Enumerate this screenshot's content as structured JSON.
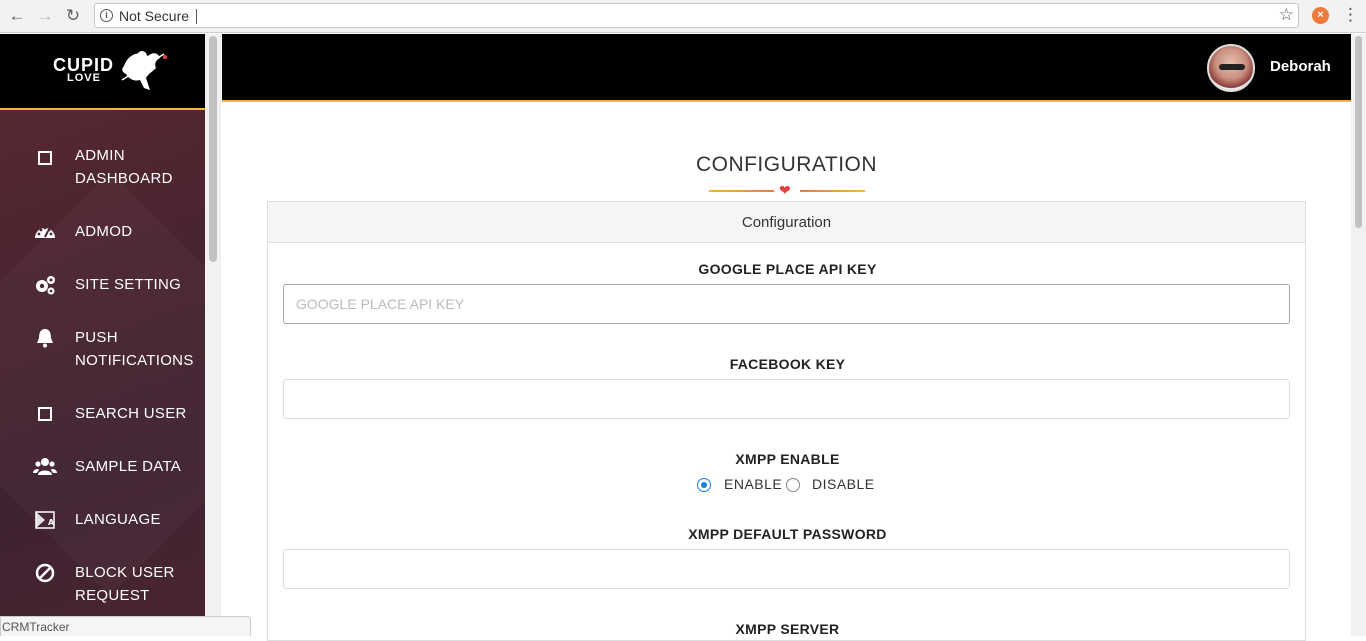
{
  "browser": {
    "security_label": "Not Secure",
    "back_icon": "arrow-left-icon",
    "forward_icon": "arrow-right-icon",
    "reload_icon": "reload-icon"
  },
  "brand": {
    "line1": "CUPID",
    "line2": "LOVE"
  },
  "sidebar": {
    "items": [
      {
        "icon": "square-icon",
        "label": "ADMIN DASHBOARD"
      },
      {
        "icon": "dashboard-gauge-icon",
        "label": "ADMOD"
      },
      {
        "icon": "gears-icon",
        "label": "SITE SETTING"
      },
      {
        "icon": "bell-icon",
        "label": "PUSH NOTIFICATIONS"
      },
      {
        "icon": "square-icon",
        "label": "SEARCH USER"
      },
      {
        "icon": "users-icon",
        "label": "SAMPLE DATA"
      },
      {
        "icon": "language-icon",
        "label": "LANGUAGE"
      },
      {
        "icon": "ban-icon",
        "label": "BLOCK USER REQUEST"
      }
    ]
  },
  "header": {
    "username": "Deborah"
  },
  "main": {
    "title": "CONFIGURATION",
    "card_title": "Configuration",
    "fields": {
      "google_label": "GOOGLE PLACE API KEY",
      "google_placeholder": "GOOGLE PLACE API KEY",
      "google_value": "",
      "facebook_label": "FACEBOOK KEY",
      "facebook_value": "",
      "xmpp_enable_label": "XMPP ENABLE",
      "xmpp_enable_option": "ENABLE",
      "xmpp_disable_option": "DISABLE",
      "xmpp_selected": "ENABLE",
      "xmpp_password_label": "XMPP DEFAULT PASSWORD",
      "xmpp_password_value": "",
      "xmpp_server_label": "XMPP SERVER"
    }
  },
  "status_bar": {
    "text": "CRMTracker"
  },
  "colors": {
    "accent": "#f5b731",
    "radio": "#1a7fe0",
    "heart": "#e8403b"
  }
}
